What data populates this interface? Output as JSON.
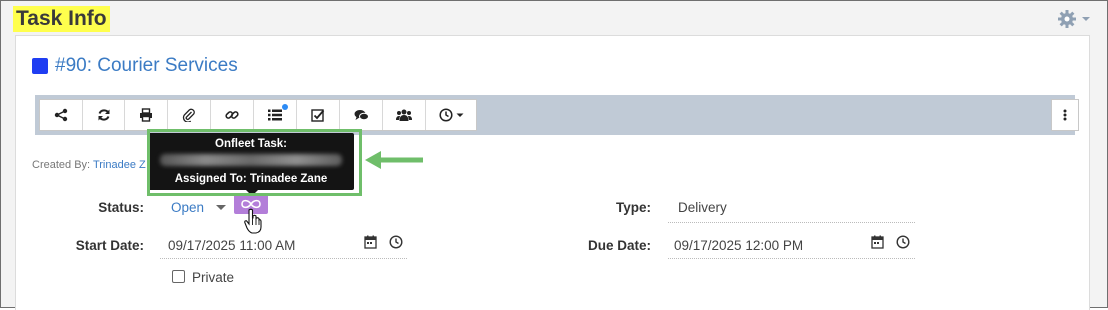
{
  "page": {
    "title": "Task Info"
  },
  "task": {
    "title": "#90: Courier Services",
    "color": "#1f3df2"
  },
  "toolbar": {
    "buttons": [
      {
        "icon": "share-icon"
      },
      {
        "icon": "refresh-icon"
      },
      {
        "icon": "print-icon"
      },
      {
        "icon": "paperclip-icon"
      },
      {
        "icon": "link-icon"
      },
      {
        "icon": "list-icon",
        "has_badge": true
      },
      {
        "icon": "checkbox-icon"
      },
      {
        "icon": "comments-icon"
      },
      {
        "icon": "users-icon"
      },
      {
        "icon": "clock-dropdown-icon"
      }
    ],
    "more_icon": "vertical-ellipsis-icon"
  },
  "created_by": {
    "label": "Created By:",
    "name": "Trinadee Z"
  },
  "tooltip": {
    "title": "Onfleet Task:",
    "assigned": "Assigned To: Trinadee Zane"
  },
  "fields": {
    "status": {
      "label": "Status:",
      "value": "Open"
    },
    "type": {
      "label": "Type:",
      "value": "Delivery"
    },
    "start_date": {
      "label": "Start Date:",
      "value": "09/17/2025 11:00 AM"
    },
    "due_date": {
      "label": "Due Date:",
      "value": "09/17/2025 12:00 PM"
    },
    "private": {
      "label": "Private",
      "checked": false
    }
  },
  "colors": {
    "highlight": "#ffff4d",
    "toolbar_bg": "#c0cad6",
    "onfleet": "#b37ed9",
    "annotation": "#6fbe6a",
    "link": "#3b7bc4"
  }
}
